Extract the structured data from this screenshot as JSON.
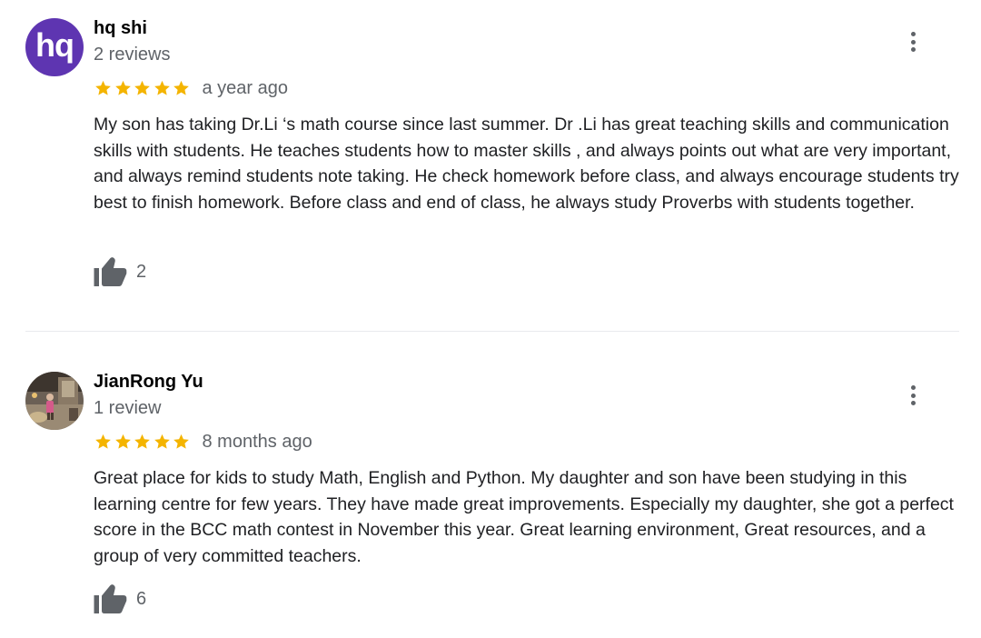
{
  "reviews": [
    {
      "avatar": {
        "kind": "text",
        "text": "hq",
        "background": "#5e35b1"
      },
      "name": "hq shi",
      "review_count": "2 reviews",
      "stars": 5,
      "time": "a year ago",
      "text": "My son has taking Dr.Li ‘s math course since last summer. Dr .Li has great teaching skills and communication skills with students. He teaches students how to master skills , and always points out what are very important, and always remind students note taking. He check homework before class, and always encourage students try best to finish homework. Before class and end of class, he always study Proverbs with students together.",
      "likes": "2"
    },
    {
      "avatar": {
        "kind": "photo"
      },
      "name": "JianRong Yu",
      "review_count": "1 review",
      "stars": 5,
      "time": "8 months ago",
      "text": "Great place for kids to study Math, English and Python. My daughter and son have been studying in this learning centre for few years. They have made great improvements. Especially my daughter, she got a perfect score in the BCC math contest in November this year. Great learning environment, Great resources, and a group of very committed teachers.",
      "likes": "6"
    }
  ],
  "icons": {
    "star": "star-icon",
    "like": "thumbs-up-icon",
    "more": "more-vert-icon"
  },
  "colors": {
    "star": "#f4b400",
    "secondary_text": "#5f6368",
    "primary_text": "#202124",
    "divider": "#e8eaed"
  }
}
